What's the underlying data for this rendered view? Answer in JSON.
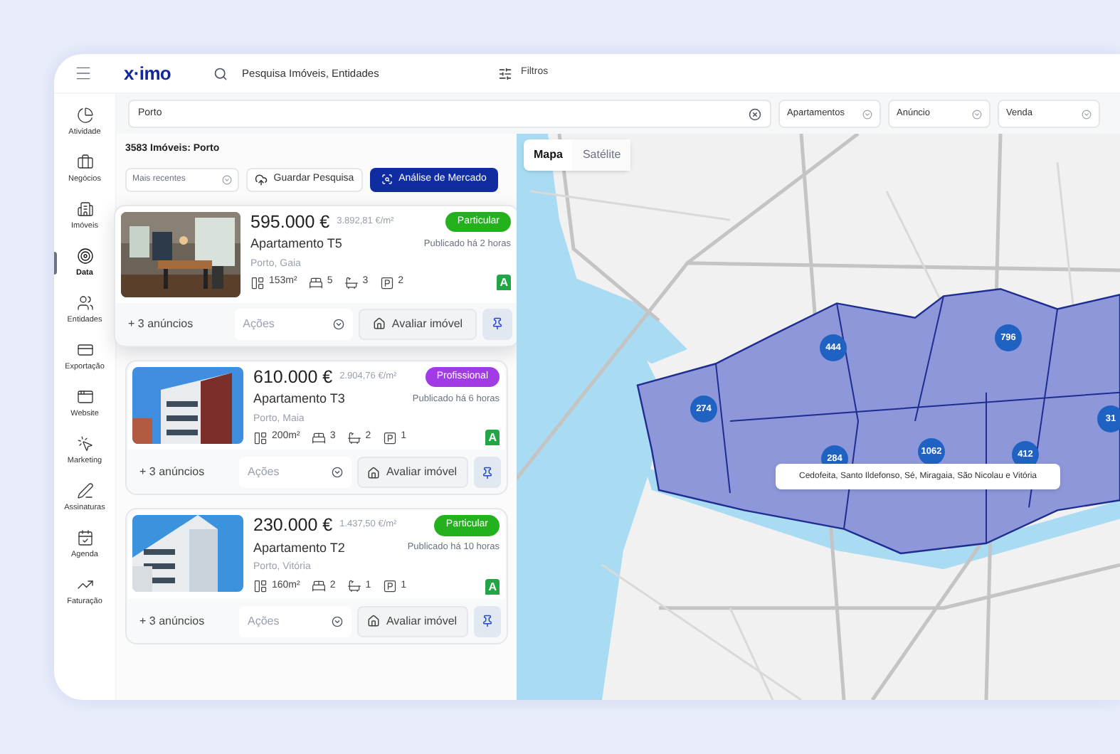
{
  "topbar": {
    "logo": "x·imo",
    "search_placeholder": "Pesquisa Imóveis, Entidades",
    "filters_label": "Filtros"
  },
  "sidebar": {
    "items": [
      {
        "label": "Atividade",
        "selected": false
      },
      {
        "label": "Negócios",
        "selected": false
      },
      {
        "label": "Imóveis",
        "selected": false
      },
      {
        "label": "Data",
        "selected": true
      },
      {
        "label": "Entidades",
        "selected": false
      },
      {
        "label": "Exportação",
        "selected": false
      },
      {
        "label": "Website",
        "selected": false
      },
      {
        "label": "Marketing",
        "selected": false
      },
      {
        "label": "Assinaturas",
        "selected": false
      },
      {
        "label": "Agenda",
        "selected": false
      },
      {
        "label": "Faturação",
        "selected": false
      }
    ]
  },
  "filters": {
    "location": "Porto",
    "dropdowns": [
      {
        "value": "Apartamentos"
      },
      {
        "value": "Anúncio"
      },
      {
        "value": "Venda"
      }
    ]
  },
  "results": {
    "count_label": "3583 Imóveis: Porto",
    "sort": "Mais recentes",
    "save_button": "Guardar Pesquisa",
    "analysis_button": "Análise de Mercado"
  },
  "listings": [
    {
      "highlighted": true,
      "price": "595.000 €",
      "price_per_m2": "3.892,81 €/m²",
      "badge": {
        "label": "Particular",
        "color": "#23b11e"
      },
      "title": "Apartamento T5",
      "published": "Publicado há 2 horas",
      "location": "Porto, Gaia",
      "area": "153m²",
      "bedrooms": "5",
      "bathrooms": "3",
      "parking": "2",
      "energy": "A",
      "more": "+ 3 anúncios",
      "actions": "Ações",
      "evaluate": "Avaliar imóvel"
    },
    {
      "highlighted": false,
      "price": "610.000 €",
      "price_per_m2": "2.904,76 €/m²",
      "badge": {
        "label": "Profissional",
        "color": "#a13be6"
      },
      "title": "Apartamento T3",
      "published": "Publicado há 6 horas",
      "location": "Porto, Maia",
      "area": "200m²",
      "bedrooms": "3",
      "bathrooms": "2",
      "parking": "1",
      "energy": "A",
      "more": "+ 3 anúncios",
      "actions": "Ações",
      "evaluate": "Avaliar imóvel"
    },
    {
      "highlighted": false,
      "price": "230.000 €",
      "price_per_m2": "1.437,50 €/m²",
      "badge": {
        "label": "Particular",
        "color": "#23b11e"
      },
      "title": "Apartamento T2",
      "published": "Publicado há 10 horas",
      "location": "Porto, Vitória",
      "area": "160m²",
      "bedrooms": "2",
      "bathrooms": "1",
      "parking": "1",
      "energy": "A",
      "more": "+ 3 anúncios",
      "actions": "Ações",
      "evaluate": "Avaliar imóvel"
    }
  ],
  "map": {
    "tabs": [
      {
        "label": "Mapa",
        "selected": true
      },
      {
        "label": "Satélite",
        "selected": false
      }
    ],
    "clusters": [
      {
        "count": "444"
      },
      {
        "count": "796"
      },
      {
        "count": "274"
      },
      {
        "count": "284"
      },
      {
        "count": "1062"
      },
      {
        "count": "412"
      },
      {
        "count": "31"
      }
    ],
    "tooltip": "Cedofeita, Santo Ildefonso, Sé, Miragaia, São Nicolau e Vitória"
  }
}
